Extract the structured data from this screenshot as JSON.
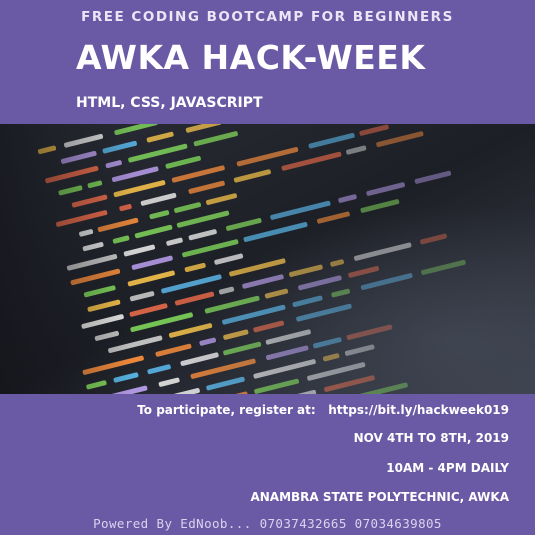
{
  "poster": {
    "tagline": "FREE CODING BOOTCAMP FOR BEGINNERS",
    "title": "AWKA HACK-WEEK",
    "technologies": "HTML, CSS, JAVASCRIPT",
    "register_prefix": "To participate, register at:",
    "register_url": "https://bit.ly/hackweek019",
    "dates": "NOV 4TH TO 8TH, 2019",
    "hours": "10AM - 4PM DAILY",
    "venue": "ANAMBRA STATE POLYTECHNIC, AWKA",
    "credits": "Powered By EdNoob... 07037432665 07034639805"
  },
  "colors": {
    "background": "#6a5aa5",
    "text": "#ffffff"
  }
}
